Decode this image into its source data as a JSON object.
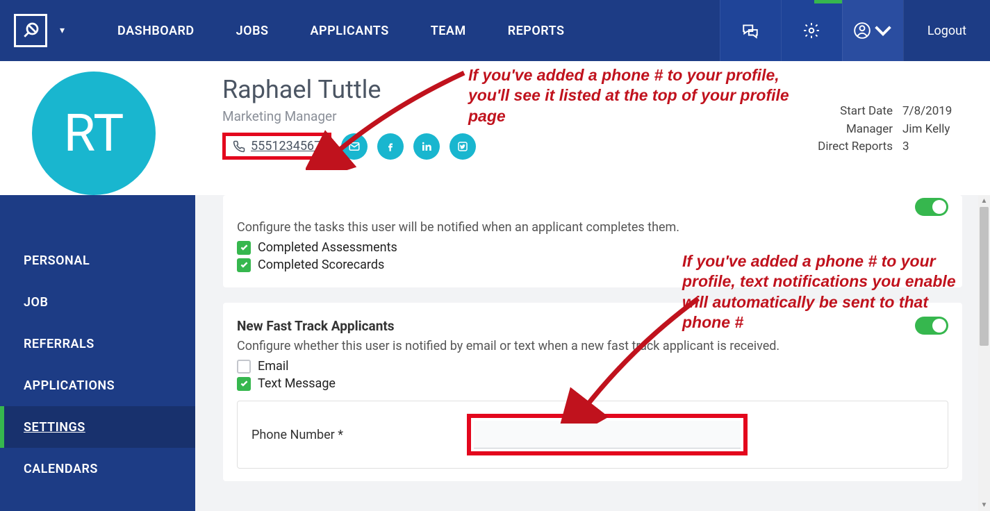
{
  "nav": {
    "dashboard": "DASHBOARD",
    "jobs": "JOBS",
    "applicants": "APPLICANTS",
    "team": "TEAM",
    "reports": "REPORTS",
    "logout": "Logout"
  },
  "profile": {
    "initials": "RT",
    "name": "Raphael Tuttle",
    "title": "Marketing Manager",
    "phone": "5551234567",
    "meta": {
      "start_date_label": "Start Date",
      "start_date": "7/8/2019",
      "manager_label": "Manager",
      "manager": "Jim Kelly",
      "direct_reports_label": "Direct Reports",
      "direct_reports": "3"
    }
  },
  "sidebar": {
    "personal": "PERSONAL",
    "job": "JOB",
    "referrals": "REFERRALS",
    "applications": "APPLICATIONS",
    "settings": "SETTINGS",
    "calendars": "CALENDARS"
  },
  "sections": {
    "applicant_tasks": {
      "desc": "Configure the tasks this user will be notified when an applicant completes them.",
      "opt1": "Completed Assessments",
      "opt2": "Completed Scorecards"
    },
    "fasttrack": {
      "title": "New Fast Track Applicants",
      "desc": "Configure whether this user is notified by email or text when a new fast track applicant is received.",
      "email_label": "Email",
      "text_label": "Text Message",
      "phone_label": "Phone Number *"
    }
  },
  "annotations": {
    "top": "If you've added a phone # to your profile, you'll see it listed at the top of your profile page",
    "bottom": "If you've added a phone # to your profile, text notifications you enable will automatically be sent to that phone #"
  }
}
